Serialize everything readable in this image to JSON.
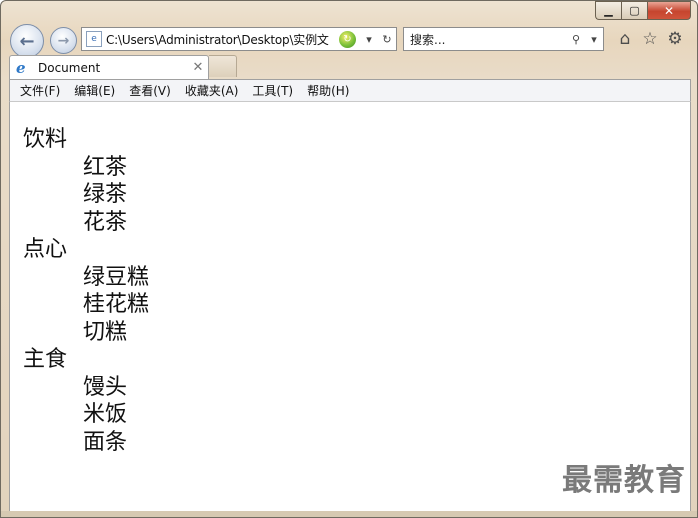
{
  "window": {
    "caption_minimize": "▁",
    "caption_maximize": "▢",
    "caption_close": "✕"
  },
  "nav": {
    "back_icon": "arrow-left-icon",
    "forward_icon": "arrow-right-icon",
    "address_url": "C:\\Users\\Administrator\\Desktop\\实例文",
    "search_placeholder": "搜索..."
  },
  "tab": {
    "title": "Document"
  },
  "menu": {
    "items": [
      "文件(F)",
      "编辑(E)",
      "查看(V)",
      "收藏夹(A)",
      "工具(T)",
      "帮助(H)"
    ]
  },
  "content": {
    "groups": [
      {
        "title": "饮料",
        "items": [
          "红茶",
          "绿茶",
          "花茶"
        ]
      },
      {
        "title": "点心",
        "items": [
          "绿豆糕",
          "桂花糕",
          "切糕"
        ]
      },
      {
        "title": "主食",
        "items": [
          "馒头",
          "米饭",
          "面条"
        ]
      }
    ]
  },
  "watermark": "最需教育"
}
